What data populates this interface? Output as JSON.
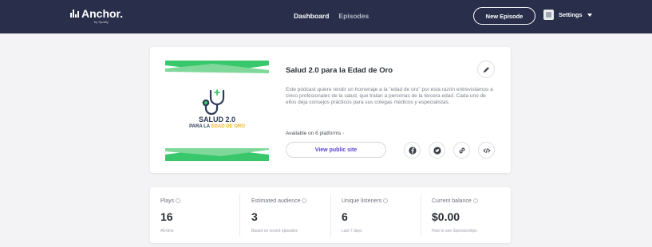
{
  "header": {
    "logo_text": "Anchor.",
    "logo_sub": "by Spotify",
    "nav": [
      "Dashboard",
      "Episodes"
    ],
    "new_episode_label": "New Episode",
    "settings_label": "Settings"
  },
  "podcast": {
    "cover_line1": "SALUD 2.0",
    "cover_line2_prefix": "PARA LA ",
    "cover_line2_highlight": "EDAD DE ORO",
    "title": "Salud 2.0 para la Edad de Oro",
    "description": "Este pódcast quiere rendir un homenaje a la \"edad de oro\" por esta razón entrevistamos a cinco profesionales de la salud, que tratan a personas de la tercera edad. Cada uno de ellos deja consejos prácticos para sus colegas médicos y especialistas.",
    "available_text": "Available on 6 platforms",
    "view_public_site_label": "View public site",
    "colors": {
      "green": "#38c76b",
      "navy": "#2d3b56",
      "yellow": "#f0b21b",
      "accent": "#5a3ed0"
    }
  },
  "stats": [
    {
      "label": "Plays",
      "value": "16",
      "sub": "All-time"
    },
    {
      "label": "Estimated audience",
      "value": "3",
      "sub": "Based on recent episodes"
    },
    {
      "label": "Unique listeners",
      "value": "6",
      "sub": "Last 7 days"
    },
    {
      "label": "Current balance",
      "value": "$0.00",
      "sub": "How to see Sponsorships"
    }
  ]
}
